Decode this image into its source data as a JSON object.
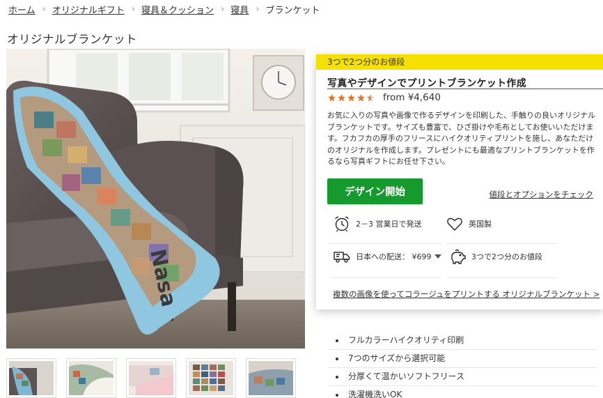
{
  "breadcrumb": {
    "items": [
      "ホーム",
      "オリジナルギフト",
      "寝具＆クッション",
      "寝具"
    ],
    "current": "ブランケット",
    "separator": "›"
  },
  "page_title": "オリジナルブランケット",
  "thumbnails": [
    {
      "icon": "blanket-on-sofa-thumbnail"
    },
    {
      "icon": "blanket-folded-thumbnail"
    },
    {
      "icon": "blanket-bed-thumbnail"
    },
    {
      "icon": "photo-collage-blanket-thumbnail"
    },
    {
      "icon": "blanket-photo-thumbnail"
    }
  ],
  "card": {
    "promo": "3つで2つ分のお値段",
    "title": "写真やデザインでプリントブランケット作成",
    "rating_stars": 4.5,
    "price": "from ¥4,640",
    "description": "お気に入りの写真や画像で作るデザインを印刷した、手触りの良いオリジナルブランケットです。サイズも豊富で、ひざ掛けや毛布としてお使いいただけます。フカフカの厚手のフリースにハイクオリティプリントを施し、あなただけのオリジナルを作成します。プレゼントにも最適なプリントブランケットを作るなら写真ギフトにお任せ下さい。",
    "design_button": "デザイン開始",
    "options_link": "値段とオプションをチェック",
    "features": [
      {
        "icon": "alarm-clock-icon",
        "text": "2－3 営業日で発送"
      },
      {
        "icon": "heart-icon",
        "text": "英国製"
      },
      {
        "icon": "delivery-truck-icon",
        "text": "日本への配送：  ¥699"
      },
      {
        "icon": "piggy-bank-icon",
        "text": "3つで2つ分のお値段"
      }
    ],
    "collage_link": "複数の画像を使ってコラージュをプリントする オリジナルブランケット >"
  },
  "bullets": [
    "フルカラーハイクオリティ印刷",
    "7つのサイズから選択可能",
    "分厚くて温かいソフトフリース",
    "洗濯機洗いOK"
  ],
  "colors": {
    "promo_bg": "#f5e000",
    "button_green": "#169a2e",
    "star_orange": "#e87722"
  }
}
